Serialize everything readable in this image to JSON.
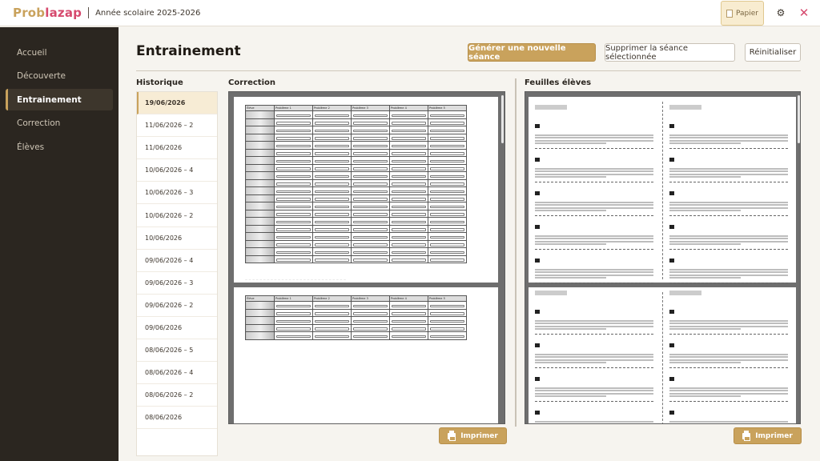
{
  "app": {
    "name_part1": "Prob",
    "name_part2": "lazap",
    "school_year": "Année scolaire 2025-2026",
    "papier_label": "Papier",
    "brand_gold": "#c9a25c",
    "brand_pink": "#d64a6e"
  },
  "sidebar": {
    "items": [
      {
        "label": "Accueil",
        "active": false
      },
      {
        "label": "Découverte",
        "active": false
      },
      {
        "label": "Entrainement",
        "active": true
      },
      {
        "label": "Correction",
        "active": false
      },
      {
        "label": "Élèves",
        "active": false
      }
    ]
  },
  "main": {
    "title": "Entrainement",
    "generate_label": "Générer une nouvelle séance",
    "delete_label": "Supprimer la séance sélectionnée",
    "reset_label": "Réinitialiser"
  },
  "history": {
    "title": "Historique",
    "items": [
      {
        "label": "19/06/2026",
        "active": true
      },
      {
        "label": "11/06/2026 – 2",
        "active": false
      },
      {
        "label": "11/06/2026",
        "active": false
      },
      {
        "label": "10/06/2026 – 4",
        "active": false
      },
      {
        "label": "10/06/2026 – 3",
        "active": false
      },
      {
        "label": "10/06/2026 – 2",
        "active": false
      },
      {
        "label": "10/06/2026",
        "active": false
      },
      {
        "label": "09/06/2026 – 4",
        "active": false
      },
      {
        "label": "09/06/2026 – 3",
        "active": false
      },
      {
        "label": "09/06/2026 – 2",
        "active": false
      },
      {
        "label": "09/06/2026",
        "active": false
      },
      {
        "label": "08/06/2026 – 5",
        "active": false
      },
      {
        "label": "08/06/2026 – 4",
        "active": false
      },
      {
        "label": "08/06/2026 – 2",
        "active": false
      },
      {
        "label": "08/06/2026",
        "active": false
      }
    ]
  },
  "correction": {
    "title": "Correction",
    "table_header": [
      "Élève",
      "Problème 1",
      "Problème 2",
      "Problème 3",
      "Problème 4",
      "Problème 5"
    ],
    "print_label": "Imprimer"
  },
  "students": {
    "title": "Feuilles élèves",
    "print_label": "Imprimer"
  }
}
